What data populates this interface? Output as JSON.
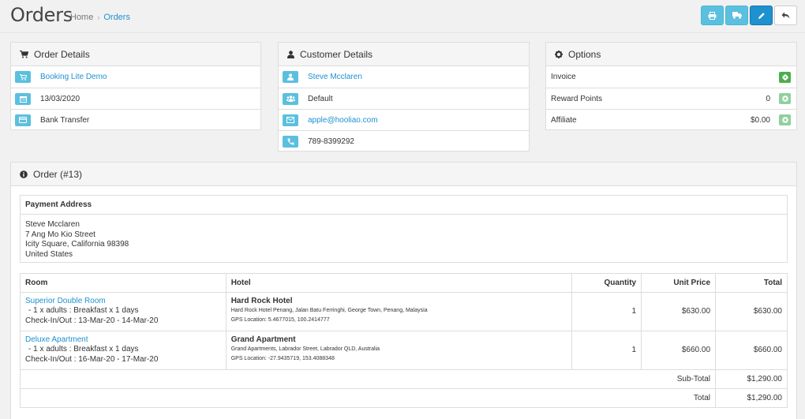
{
  "header": {
    "title": "Orders",
    "breadcrumb": [
      "Home",
      "Orders"
    ],
    "buttons": [
      "print-invoice",
      "print-shipping",
      "edit",
      "back"
    ]
  },
  "order_details": {
    "title": "Order Details",
    "store": "Booking Lite Demo",
    "date": "13/03/2020",
    "payment_method": "Bank Transfer"
  },
  "customer_details": {
    "title": "Customer Details",
    "name": "Steve Mcclaren",
    "group": "Default",
    "email": "apple@hooliao.com",
    "phone": "789-8399292"
  },
  "options": {
    "title": "Options",
    "items": [
      {
        "label": "Invoice",
        "value": ""
      },
      {
        "label": "Reward Points",
        "value": "0"
      },
      {
        "label": "Affiliate",
        "value": "$0.00"
      }
    ]
  },
  "order": {
    "title": "Order (#13)",
    "payment_address": {
      "heading": "Payment Address",
      "lines": [
        "Steve Mcclaren",
        "7 Ang Mo Kio Street",
        "Icity Square, California 98398",
        "United States"
      ]
    },
    "columns": [
      "Room",
      "Hotel",
      "Quantity",
      "Unit Price",
      "Total"
    ],
    "rows": [
      {
        "room": "Superior Double Room",
        "option": "- 1 x adults : Breakfast x 1 days",
        "checkin": "Check-In/Out : 13-Mar-20 - 14-Mar-20",
        "hotel": "Hard Rock Hotel",
        "hotel_address": "Hard Rock Hotel Penang, Jalan Batu Ferringhi, George Town, Penang, Malaysia",
        "gps": "GPS Location: 5.4677015, 100.2414777",
        "quantity": "1",
        "unit_price": "$630.00",
        "total": "$630.00"
      },
      {
        "room": "Deluxe Apartment",
        "option": "- 1 x adults : Breakfast x 1 days",
        "checkin": "Check-In/Out : 16-Mar-20 - 17-Mar-20",
        "hotel": "Grand Apartment",
        "hotel_address": "Grand Apartments, Labrador Street, Labrador QLD, Australia",
        "gps": "GPS Location: -27.9435719, 153.4088348",
        "quantity": "1",
        "unit_price": "$660.00",
        "total": "$660.00"
      }
    ],
    "subtotal_label": "Sub-Total",
    "subtotal": "$1,290.00",
    "total_label": "Total",
    "total": "$1,290.00"
  },
  "colors": {
    "accent": "#1e91cf",
    "info": "#5bc0de",
    "success": "#4cae4c"
  }
}
